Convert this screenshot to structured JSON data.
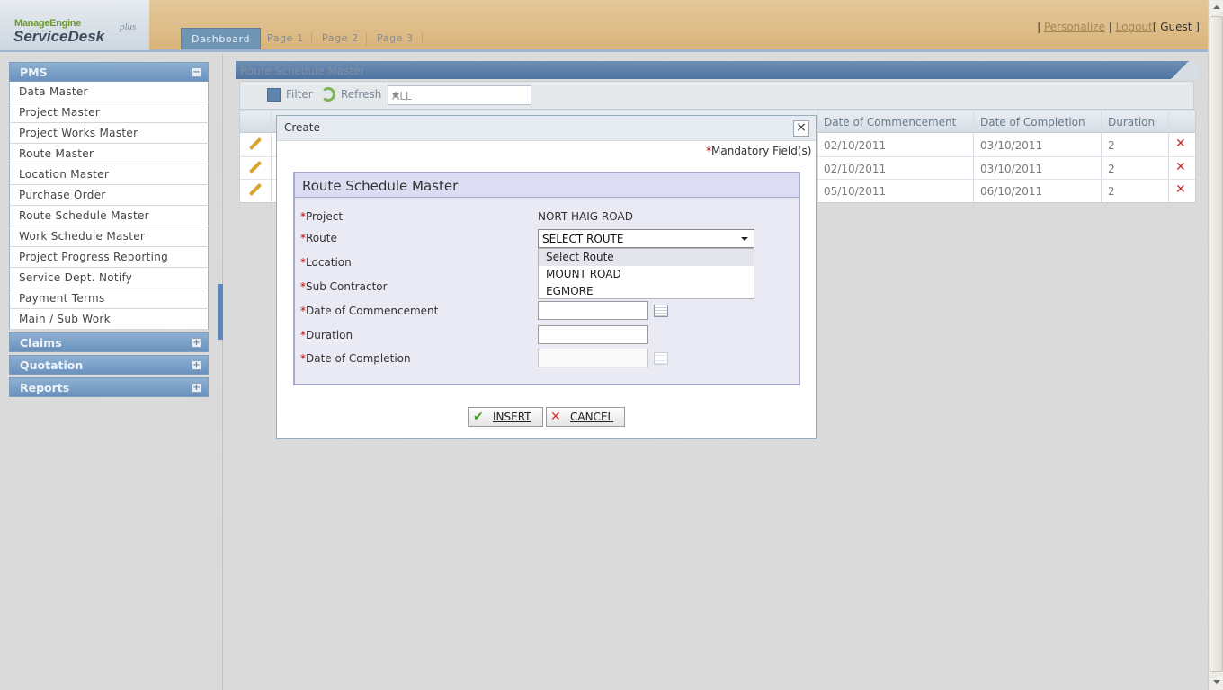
{
  "header": {
    "logo": {
      "brand": "ManageEngine",
      "product": "ServiceDesk",
      "edition": "plus"
    },
    "tabs": [
      {
        "label": "Dashboard",
        "active": true
      },
      {
        "label": "Page 1"
      },
      {
        "label": "Page 2"
      },
      {
        "label": "Page 3"
      }
    ],
    "links": {
      "personalize": "Personalize",
      "logout": "Logout",
      "user": "[ Guest ]"
    }
  },
  "sidebar": {
    "sections": [
      {
        "title": "PMS",
        "toggle": "−",
        "items": [
          "Data Master",
          "Project Master",
          "Project Works Master",
          "Route Master",
          "Location Master",
          "Purchase Order",
          "Route Schedule Master",
          "Work Schedule Master",
          "Project Progress Reporting",
          "Service Dept. Notify",
          "Payment Terms",
          "Main / Sub Work"
        ]
      },
      {
        "title": "Claims",
        "toggle": "+"
      },
      {
        "title": "Quotation",
        "toggle": "+"
      },
      {
        "title": "Reports",
        "toggle": "+"
      }
    ]
  },
  "panel": {
    "title": "Route Schedule Master",
    "toolbar": {
      "filter": "Filter",
      "refresh": "Refresh",
      "view_select": "ALL"
    },
    "grid": {
      "columns": [
        "Date of Commencement",
        "Date of Completion",
        "Duration"
      ],
      "rows": [
        {
          "commencement": "02/10/2011",
          "completion": "03/10/2011",
          "duration": "2"
        },
        {
          "commencement": "02/10/2011",
          "completion": "03/10/2011",
          "duration": "2"
        },
        {
          "commencement": "05/10/2011",
          "completion": "06/10/2011",
          "duration": "2"
        }
      ]
    }
  },
  "dialog": {
    "title": "Create",
    "close": "×",
    "mandatory": {
      "star": "*",
      "text": "Mandatory Field(s)"
    },
    "form_title": "Route Schedule Master",
    "fields": [
      {
        "star": "*",
        "label": "Project",
        "value": "NORT HAIG ROAD"
      },
      {
        "star": "*",
        "label": "Route",
        "value": "SELECT ROUTE"
      },
      {
        "star": "*",
        "label": "Location"
      },
      {
        "star": "*",
        "label": "Sub Contractor"
      },
      {
        "star": "*",
        "label": "Date of Commencement",
        "value": ""
      },
      {
        "star": "*",
        "label": "Duration",
        "value": ""
      },
      {
        "star": "*",
        "label": "Date of Completion",
        "value": ""
      }
    ],
    "route_options": [
      "Select Route",
      "MOUNT ROAD",
      "EGMORE"
    ],
    "buttons": {
      "insert": "INSERT",
      "cancel": "CANCEL"
    }
  },
  "colors": {
    "accent": "#6a92bd",
    "header": "#d9b57c",
    "required": "#cc0000",
    "delete": "#c32d2d",
    "insert_check": "#3f9b2a"
  }
}
